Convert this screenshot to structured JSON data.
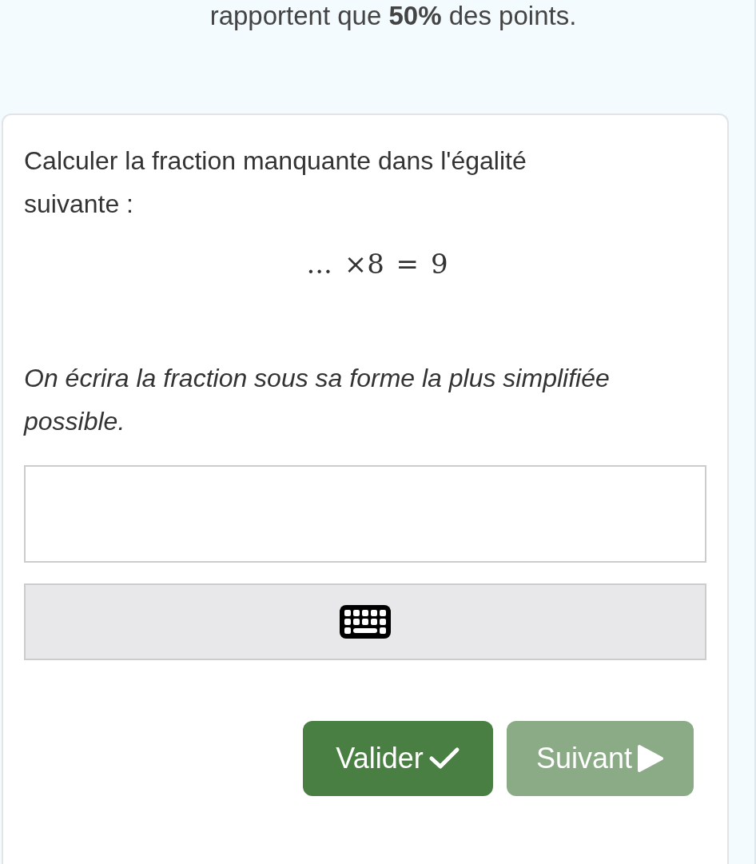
{
  "intro_text": "rapportent que **50%** des points.",
  "question": {
    "prompt": "Calculer la fraction manquante dans l'égalité suivante :",
    "equation": "... ×8 = 9",
    "instruction": "On écrira la fraction sous sa forme la plus simplifiée possible."
  },
  "buttons": [
    {
      "kind": "validate",
      "label": "Valider",
      "disabled": false
    },
    {
      "kind": "next",
      "label": "Suivant",
      "disabled": true
    }
  ]
}
